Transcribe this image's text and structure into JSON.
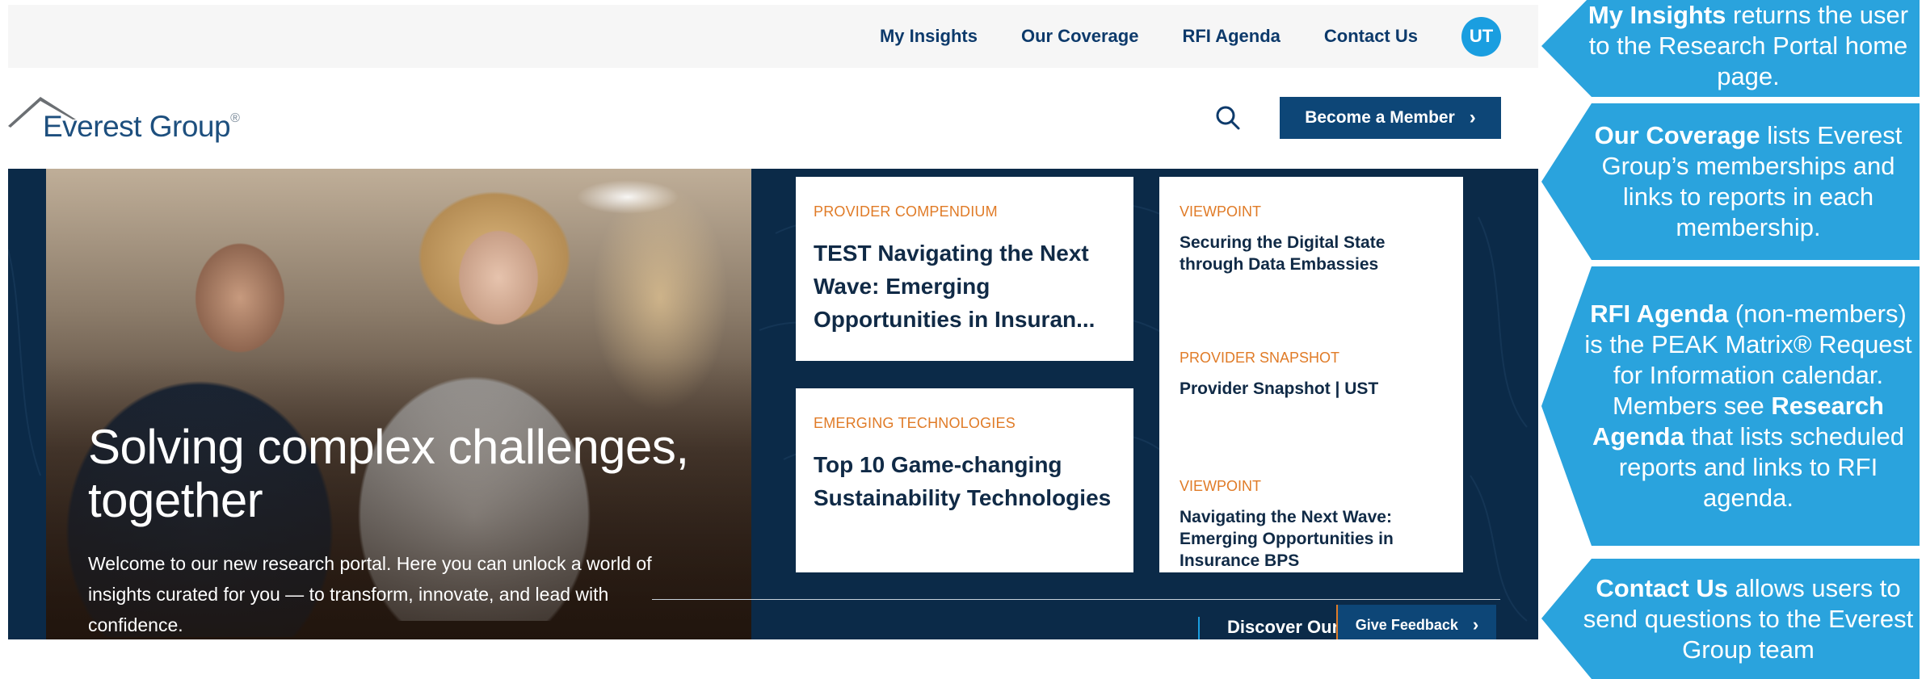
{
  "topnav": {
    "items": [
      "My Insights",
      "Our Coverage",
      "RFI Agenda",
      "Contact Us"
    ],
    "avatar": "UT"
  },
  "header": {
    "logo": "Everest Group",
    "logo_mark": "®",
    "member_button": "Become a Member",
    "chevron": "›"
  },
  "hero": {
    "title": "Solving complex challenges, together",
    "body": "Welcome to our new research portal. Here you can unlock a world of insights curated for you — to transform, innovate, and lead with confidence.",
    "discover": "Discover Our",
    "feedback_button": "Give Feedback"
  },
  "cards": [
    {
      "tag": "PROVIDER COMPENDIUM",
      "title": "TEST Navigating the Next Wave: Emerging Opportunities in Insuran..."
    },
    {
      "tag": "EMERGING TECHNOLOGIES",
      "title": "Top 10 Game-changing Sustainability Technologies"
    }
  ],
  "right_items": [
    {
      "tag": "VIEWPOINT",
      "title": "Securing the Digital State through Data Embassies"
    },
    {
      "tag": "PROVIDER SNAPSHOT",
      "title": "Provider Snapshot | UST"
    },
    {
      "tag": "VIEWPOINT",
      "title": "Navigating the Next Wave: Emerging Opportunities in Insurance BPS"
    }
  ],
  "callouts": [
    {
      "bold": "My Insights",
      "rest": " returns the user to the Research Portal home page."
    },
    {
      "bold": "Our Coverage",
      "rest": " lists Everest Group’s memberships and links to reports in each membership."
    },
    {
      "bold": "RFI Agenda",
      "rest": " (non-members) is the PEAK Matrix® Request for Information calendar. Members see ",
      "bold2": "Research Agenda",
      "rest2": " that lists scheduled reports and links to RFI agenda."
    },
    {
      "bold": "Contact Us",
      "rest": " allows users to send questions to the Everest Group team"
    }
  ],
  "colors": {
    "callout_blue": "#2aa3dd",
    "nav_navy": "#0d3a6b",
    "accent_orange": "#e07b27",
    "hero_navy": "#0b2a48"
  }
}
